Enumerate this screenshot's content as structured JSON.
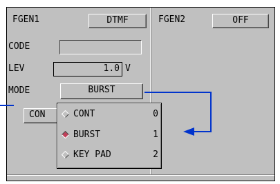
{
  "fgen1": {
    "title": "FGEN1",
    "mode_value": "DTMF",
    "code_label": "CODE",
    "code_value": "",
    "lev_label": "LEV",
    "lev_value": "1.0",
    "lev_unit": "V",
    "mode_label": "MODE",
    "mode_button": "BURST",
    "cont_button": "CON"
  },
  "fgen2": {
    "title": "FGEN2",
    "state_value": "OFF"
  },
  "mode_menu": {
    "options": [
      {
        "label": "CONT",
        "key": "0",
        "selected": false
      },
      {
        "label": "BURST",
        "key": "1",
        "selected": true
      },
      {
        "label": "KEY PAD",
        "key": "2",
        "selected": false
      }
    ]
  },
  "colors": {
    "panel_bg": "#c0c0c0",
    "annotation_line": "#0033cc",
    "selected_diamond": "#c0405a"
  }
}
